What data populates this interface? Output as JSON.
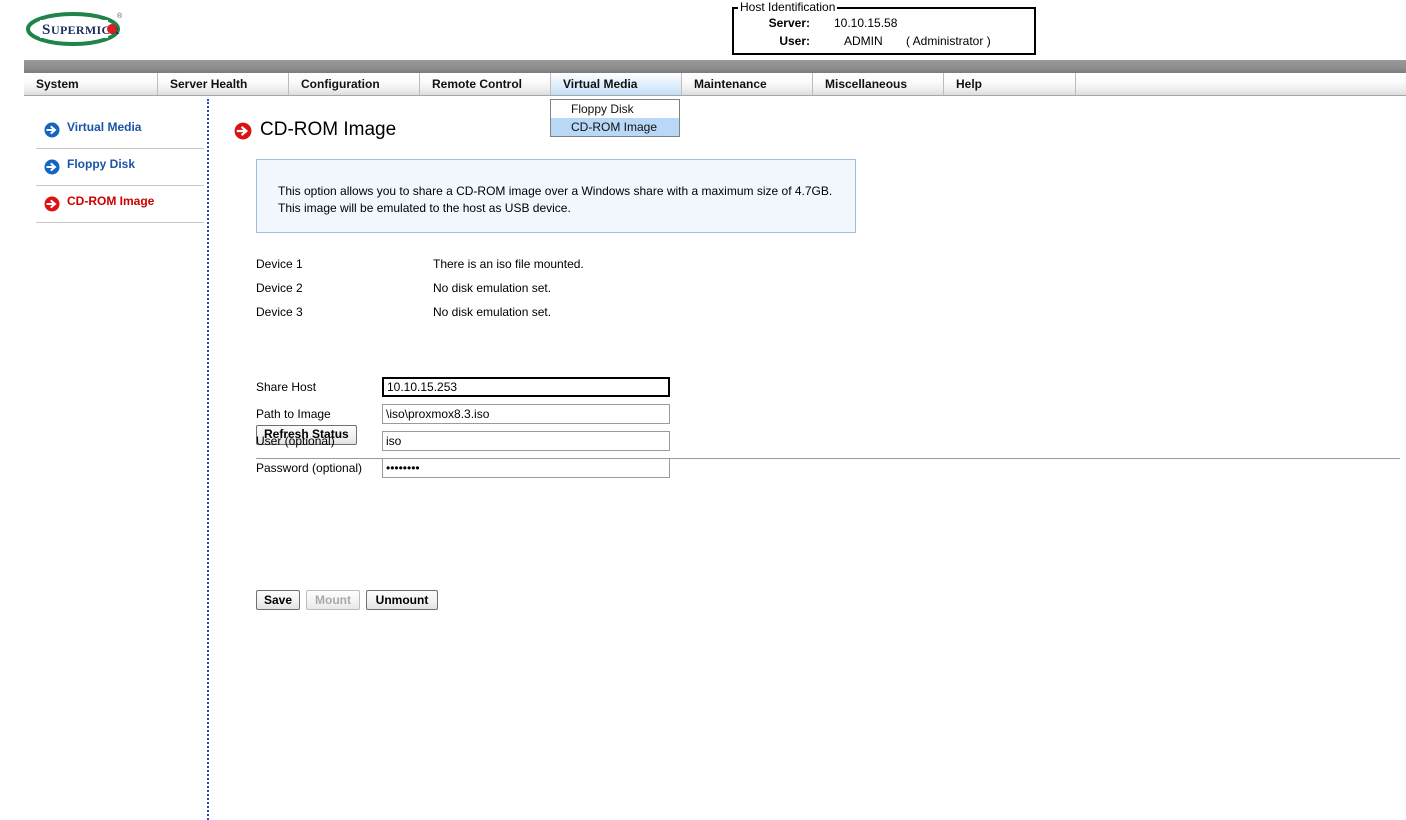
{
  "brand": {
    "logo_text": "SUPERMICRO",
    "logo_ring_color": "#1e8449",
    "logo_text_color": "#1d2d5c",
    "logo_dot_color": "#d81f26"
  },
  "host_identification": {
    "legend": "Host Identification",
    "server_label": "Server:",
    "server_value": "10.10.15.58",
    "user_label": "User:",
    "user_value": "ADMIN",
    "user_role": "( Administrator )"
  },
  "nav": {
    "tabs": [
      {
        "label": "System",
        "active": false
      },
      {
        "label": "Server Health",
        "active": false
      },
      {
        "label": "Configuration",
        "active": false
      },
      {
        "label": "Remote Control",
        "active": false
      },
      {
        "label": "Virtual Media",
        "active": true
      },
      {
        "label": "Maintenance",
        "active": false
      },
      {
        "label": "Miscellaneous",
        "active": false
      },
      {
        "label": "Help",
        "active": false
      }
    ],
    "active_tab": "Virtual Media",
    "active_tab_color": "#c3ddf7"
  },
  "dropdown": {
    "open_under": "Virtual Media",
    "items": [
      {
        "label": "Floppy Disk",
        "selected": false
      },
      {
        "label": "CD-ROM Image",
        "selected": true
      }
    ],
    "highlight_color": "#b9d7f7"
  },
  "sidebar": {
    "items": [
      {
        "label": "Virtual Media",
        "icon": "arrow-circle-right-icon",
        "color": "blue"
      },
      {
        "label": "Floppy Disk",
        "icon": "arrow-circle-right-icon",
        "color": "blue"
      },
      {
        "label": "CD-ROM Image",
        "icon": "arrow-circle-right-icon",
        "color": "red"
      }
    ]
  },
  "page": {
    "title": "CD-ROM Image",
    "title_icon": "arrow-circle-right-icon",
    "info_text": "This option allows you to share a CD-ROM image over a Windows share with a maximum size of 4.7GB. This image will be emulated to the host as USB device."
  },
  "devices": {
    "rows": [
      {
        "label": "Device 1",
        "status": "There is an iso file mounted."
      },
      {
        "label": "Device 2",
        "status": "No disk emulation set."
      },
      {
        "label": "Device 3",
        "status": "No disk emulation set."
      }
    ],
    "refresh_label": "Refresh Status"
  },
  "form": {
    "fields": [
      {
        "label": "Share Host",
        "value": "10.10.15.253",
        "placeholder": "",
        "focused": true,
        "type": "text"
      },
      {
        "label": "Path to Image",
        "value": "\\iso\\proxmox8.3.iso",
        "placeholder": "",
        "focused": false,
        "type": "text"
      },
      {
        "label": "User (optional)",
        "value": "iso",
        "placeholder": "",
        "focused": false,
        "type": "text"
      },
      {
        "label": "Password (optional)",
        "value": "••••••••",
        "placeholder": "",
        "focused": false,
        "type": "password"
      }
    ]
  },
  "actions": {
    "save_label": "Save",
    "mount_label": "Mount",
    "mount_disabled": true,
    "unmount_label": "Unmount"
  }
}
